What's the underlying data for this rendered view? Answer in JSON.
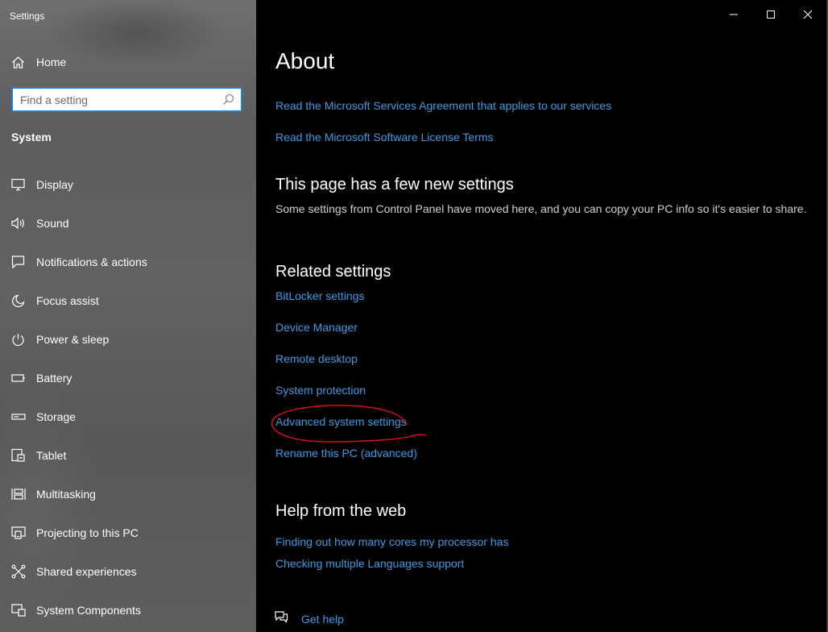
{
  "window": {
    "title": "Settings"
  },
  "sidebar": {
    "home_label": "Home",
    "search": {
      "placeholder": "Find a setting"
    },
    "section_title": "System",
    "items": [
      {
        "label": "Display",
        "icon": "display-icon"
      },
      {
        "label": "Sound",
        "icon": "sound-icon"
      },
      {
        "label": "Notifications & actions",
        "icon": "notifications-icon"
      },
      {
        "label": "Focus assist",
        "icon": "moon-icon"
      },
      {
        "label": "Power & sleep",
        "icon": "power-icon"
      },
      {
        "label": "Battery",
        "icon": "battery-icon"
      },
      {
        "label": "Storage",
        "icon": "storage-icon"
      },
      {
        "label": "Tablet",
        "icon": "tablet-icon"
      },
      {
        "label": "Multitasking",
        "icon": "multitasking-icon"
      },
      {
        "label": "Projecting to this PC",
        "icon": "projecting-icon"
      },
      {
        "label": "Shared experiences",
        "icon": "shared-experiences-icon"
      },
      {
        "label": "System Components",
        "icon": "system-components-icon"
      }
    ]
  },
  "main": {
    "title": "About",
    "top_links": [
      "Read the Microsoft Services Agreement that applies to our services",
      "Read the Microsoft Software License Terms"
    ],
    "new_settings": {
      "heading": "This page has a few new settings",
      "description": "Some settings from Control Panel have moved here, and you can copy your PC info so it's easier to share."
    },
    "related": {
      "heading": "Related settings",
      "links": [
        "BitLocker settings",
        "Device Manager",
        "Remote desktop",
        "System protection",
        "Advanced system settings",
        "Rename this PC (advanced)"
      ]
    },
    "help": {
      "heading": "Help from the web",
      "links": [
        "Finding out how many cores my processor has",
        "Checking multiple Languages support"
      ],
      "get_help": "Get help"
    }
  },
  "colors": {
    "accent_link": "#3b9ae6",
    "search_border": "#1e7fd8",
    "annotation": "#e01010"
  }
}
